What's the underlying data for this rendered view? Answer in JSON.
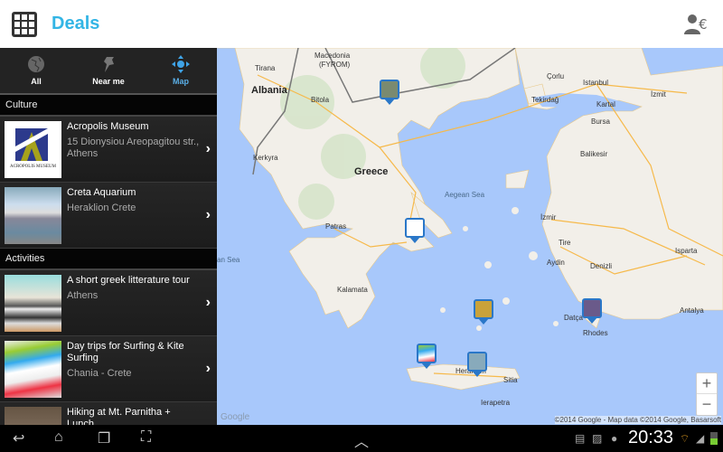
{
  "header": {
    "title": "Deals",
    "menu_icon": "app-grid-icon",
    "account_icon": "user-currency-icon"
  },
  "tabs": [
    {
      "label": "All",
      "icon": "globe-icon"
    },
    {
      "label": "Near me",
      "icon": "pin-icon"
    },
    {
      "label": "Map",
      "icon": "move-arrows-icon",
      "active": true
    }
  ],
  "sections": [
    {
      "title": "Culture",
      "items": [
        {
          "title": "Acropolis Museum",
          "subtitle": "15 Dionysiou Areopagitou str., Athens",
          "logo_text": "ACROPOLIS MUSEUM"
        },
        {
          "title": "Creta Aquarium",
          "subtitle": "Heraklion Crete"
        }
      ]
    },
    {
      "title": "Activities",
      "items": [
        {
          "title": "A short greek litterature tour",
          "subtitle": "Athens"
        },
        {
          "title": "Day trips for Surfing & Kite Surfing",
          "subtitle": "Chania - Crete"
        },
        {
          "title": "Hiking at Mt. Parnitha + Lunch",
          "subtitle": ""
        }
      ]
    }
  ],
  "map": {
    "labels": {
      "tirana": "Tirana",
      "macedonia": "Macedonia",
      "fyrom": "(FYROM)",
      "albania": "Albania",
      "bitola": "Bitola",
      "kerkyra": "Kerkyra",
      "greece": "Greece",
      "patras": "Patras",
      "kalamata": "Kalamata",
      "aegean": "Aegean Sea",
      "corlu": "Çorlu",
      "tekirdag": "Tekirdağ",
      "istanbul": "Istanbul",
      "izmit": "İzmit",
      "kartal": "Kartal",
      "bursa": "Bursa",
      "balikesir": "Balikesir",
      "izmir": "İzmir",
      "tire": "Tire",
      "aydin": "Aydin",
      "denizli": "Denizli",
      "isparta": "Isparta",
      "antalya": "Antalya",
      "datca": "Datça",
      "rhodes": "Rhodes",
      "heraklion": "Heraklion",
      "sitia": "Sitia",
      "ierapetra": "Ierapetra",
      "ionian": "an Sea"
    },
    "zoom_in": "+",
    "zoom_out": "−",
    "copyright": "©2014 Google - Map data ©2014 Google, Basarsoft",
    "logo": "Google",
    "colors": {
      "sea": "#a8c8fb",
      "land": "#f2efe9",
      "marker": "#2a77c8"
    }
  },
  "system": {
    "time": "20:33"
  }
}
